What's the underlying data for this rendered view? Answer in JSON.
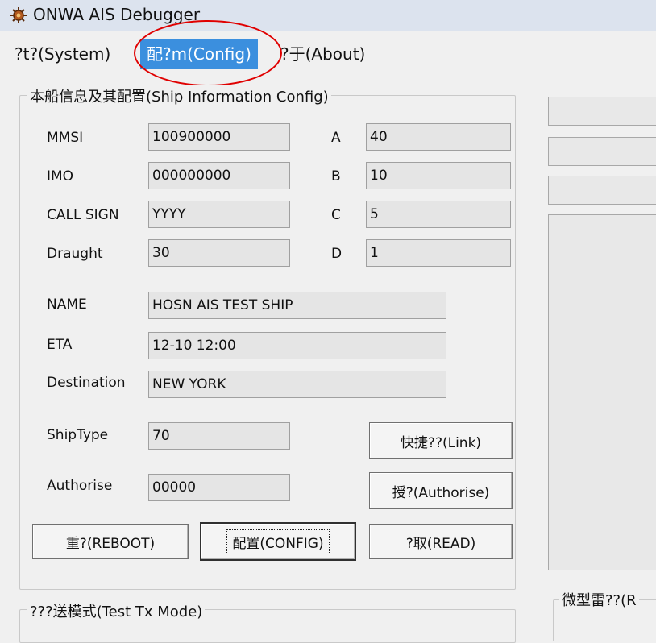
{
  "window": {
    "title": "ONWA AIS Debugger",
    "icon": "bug-gear-icon"
  },
  "menu": {
    "system": "?t?(System)",
    "config": "配?m(Config)",
    "about": "?于(About)",
    "active": "config",
    "highlight_color": "#e00000"
  },
  "ship_config": {
    "title": "本船信息及其配置(Ship Information Config)",
    "fields": {
      "mmsi": {
        "label": "MMSI",
        "value": "100900000"
      },
      "imo": {
        "label": "IMO",
        "value": "000000000"
      },
      "call_sign": {
        "label": "CALL SIGN",
        "value": "YYYY"
      },
      "draught": {
        "label": "Draught",
        "value": "30"
      },
      "a": {
        "label": "A",
        "value": "40"
      },
      "b": {
        "label": "B",
        "value": "10"
      },
      "c": {
        "label": "C",
        "value": "5"
      },
      "d": {
        "label": "D",
        "value": "1"
      },
      "name": {
        "label": "NAME",
        "value": "HOSN AIS TEST SHIP"
      },
      "eta": {
        "label": "ETA",
        "value": "12-10 12:00"
      },
      "destination": {
        "label": "Destination",
        "value": "NEW YORK"
      },
      "ship_type": {
        "label": "ShipType",
        "value": "70"
      },
      "authorise": {
        "label": "Authorise",
        "value": "00000"
      }
    },
    "buttons": {
      "link": "快捷??(Link)",
      "authorise": "授?(Authorise)",
      "reboot": "重?(REBOOT)",
      "config": "配置(CONFIG)",
      "read": "?取(READ)"
    }
  },
  "test_tx": {
    "title": "???送模式(Test Tx Mode)"
  },
  "radar": {
    "title": "微型雷??(R"
  }
}
